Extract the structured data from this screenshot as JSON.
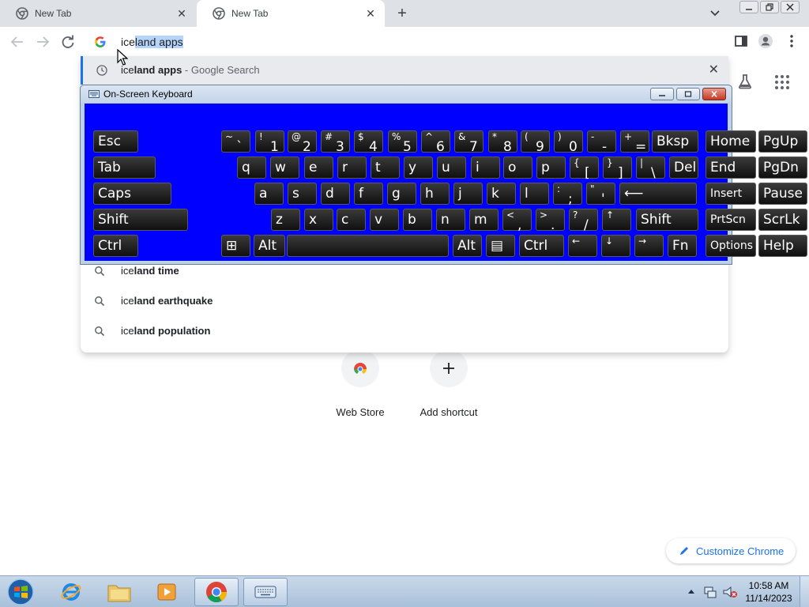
{
  "tabs": [
    {
      "title": "New Tab"
    },
    {
      "title": "New Tab"
    }
  ],
  "omnibox": {
    "typed": "ice",
    "completion": "land apps"
  },
  "suggestions": {
    "selected": {
      "typed": "ice",
      "bold": "land apps",
      "suffix": " - Google Search"
    },
    "items": [
      {
        "typed": "ice",
        "bold": "land time"
      },
      {
        "typed": "ice",
        "bold": "land earthquake"
      },
      {
        "typed": "ice",
        "bold": "land population"
      }
    ]
  },
  "keyboard": {
    "title": "On-Screen Keyboard",
    "rows": [
      [
        {
          "main": "Esc"
        },
        {
          "top": "~",
          "bot": "`"
        },
        {
          "top": "!",
          "bot": "1"
        },
        {
          "top": "@",
          "bot": "2"
        },
        {
          "top": "#",
          "bot": "3"
        },
        {
          "top": "$",
          "bot": "4"
        },
        {
          "top": "%",
          "bot": "5"
        },
        {
          "top": "^",
          "bot": "6"
        },
        {
          "top": "&",
          "bot": "7"
        },
        {
          "top": "*",
          "bot": "8"
        },
        {
          "top": "(",
          "bot": "9"
        },
        {
          "top": ")",
          "bot": "0"
        },
        {
          "top": "-",
          "bot": "-"
        },
        {
          "top": "+",
          "bot": "="
        },
        {
          "main": "Bksp"
        },
        {
          "main": "Home"
        },
        {
          "main": "PgUp"
        }
      ],
      [
        {
          "main": "Tab"
        },
        {
          "main": "q"
        },
        {
          "main": "w"
        },
        {
          "main": "e"
        },
        {
          "main": "r"
        },
        {
          "main": "t"
        },
        {
          "main": "y"
        },
        {
          "main": "u"
        },
        {
          "main": "i"
        },
        {
          "main": "o"
        },
        {
          "main": "p"
        },
        {
          "top": "{",
          "bot": "["
        },
        {
          "top": "}",
          "bot": "]"
        },
        {
          "top": "|",
          "bot": "\\"
        },
        {
          "main": "Del"
        },
        {
          "main": "End"
        },
        {
          "main": "PgDn"
        }
      ],
      [
        {
          "main": "Caps"
        },
        {
          "main": "a"
        },
        {
          "main": "s"
        },
        {
          "main": "d"
        },
        {
          "main": "f"
        },
        {
          "main": "g"
        },
        {
          "main": "h"
        },
        {
          "main": "j"
        },
        {
          "main": "k"
        },
        {
          "main": "l"
        },
        {
          "top": ":",
          "bot": ";"
        },
        {
          "top": "\"",
          "bot": "'"
        },
        {
          "main": "⟵"
        },
        {
          "main": "Insert"
        },
        {
          "main": "Pause"
        }
      ],
      [
        {
          "main": "Shift"
        },
        {
          "main": "z"
        },
        {
          "main": "x"
        },
        {
          "main": "c"
        },
        {
          "main": "v"
        },
        {
          "main": "b"
        },
        {
          "main": "n"
        },
        {
          "main": "m"
        },
        {
          "top": "<",
          "bot": ","
        },
        {
          "top": ">",
          "bot": "."
        },
        {
          "top": "?",
          "bot": "/"
        },
        {
          "top": "↑",
          "bot": ""
        },
        {
          "main": "Shift"
        },
        {
          "main": "PrtScn"
        },
        {
          "main": "ScrLk"
        }
      ],
      [
        {
          "main": "Ctrl"
        },
        {
          "main": "⊞"
        },
        {
          "main": "Alt"
        },
        {
          "main": ""
        },
        {
          "main": "Alt"
        },
        {
          "main": "▤"
        },
        {
          "main": "Ctrl"
        },
        {
          "top": "←",
          "bot": ""
        },
        {
          "top": "↓",
          "bot": ""
        },
        {
          "top": "→",
          "bot": ""
        },
        {
          "main": "Fn"
        },
        {
          "main": "Options"
        },
        {
          "main": "Help"
        }
      ]
    ]
  },
  "shortcuts": [
    {
      "name": "Web Store"
    },
    {
      "name": "Add shortcut"
    }
  ],
  "customize_label": "Customize Chrome",
  "taskbar": {
    "time": "10:58 AM",
    "date": "11/14/2023"
  },
  "colors": {
    "accent": "#1a73e8",
    "osk_background": "#0000ff",
    "selection": "#b5d4fb"
  }
}
